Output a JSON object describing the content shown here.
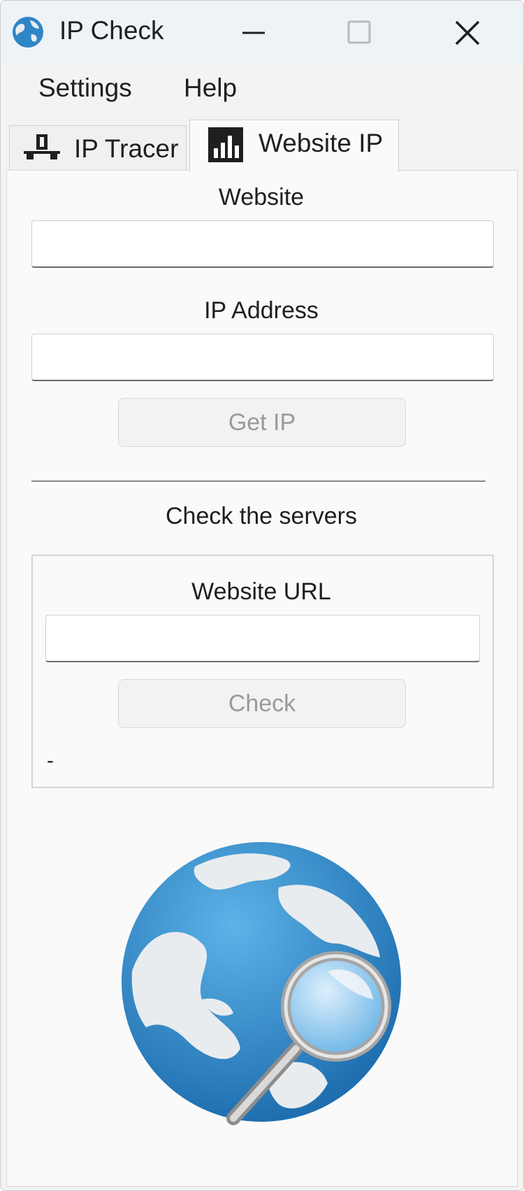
{
  "window": {
    "title": "IP Check",
    "controls": {
      "minimize_icon": "minimize-icon",
      "maximize_icon": "maximize-icon",
      "close_icon": "close-icon"
    }
  },
  "menu": {
    "items": [
      "Settings",
      "Help"
    ]
  },
  "tabs": [
    {
      "label": "IP Tracer",
      "icon": "network-icon",
      "selected": false
    },
    {
      "label": "Website IP",
      "icon": "bar-chart-icon",
      "selected": true
    }
  ],
  "website_ip": {
    "website_label": "Website",
    "website_value": "",
    "ip_label": "IP Address",
    "ip_value": "",
    "get_ip_button": "Get IP",
    "section_title": "Check the servers",
    "url_label": "Website URL",
    "url_value": "",
    "check_button": "Check",
    "status": "-"
  },
  "colors": {
    "accent_blue": "#2f86c7",
    "disabled_text": "#9a9a9a"
  }
}
